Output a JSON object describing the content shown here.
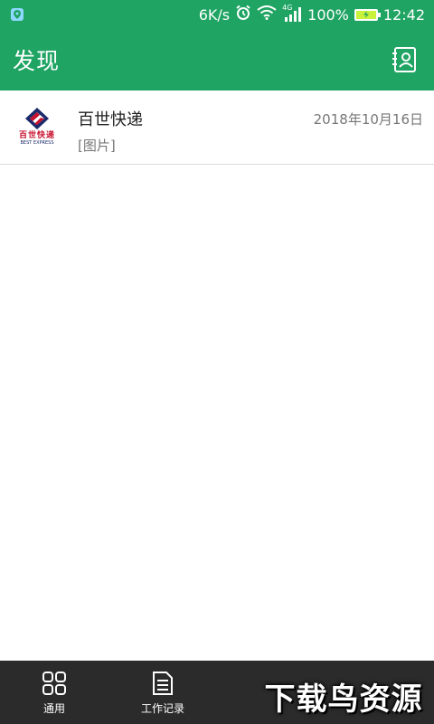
{
  "status_bar": {
    "net_speed": "6K/s",
    "network": "4G",
    "battery": "100%",
    "time": "12:42",
    "icons": [
      "notification-icon",
      "alarm-icon",
      "wifi-icon",
      "signal-icon",
      "battery-icon"
    ]
  },
  "app_bar": {
    "title": "发现",
    "action_icon": "contacts-icon"
  },
  "list": [
    {
      "title": "百世快递",
      "subtitle": "[图片]",
      "date": "2018年10月16日",
      "logo": {
        "cn": "百世快递",
        "en": "BEST EXPRESS"
      }
    }
  ],
  "bottom_nav": {
    "items": [
      {
        "label": "通用",
        "icon": "grid-icon"
      },
      {
        "label": "工作记录",
        "icon": "document-icon"
      }
    ]
  },
  "watermark": "下载鸟资源",
  "colors": {
    "primary": "#1fa463",
    "nav_background": "#2b2b2b",
    "brand_red": "#c8102e",
    "brand_navy": "#1b2a6b"
  }
}
